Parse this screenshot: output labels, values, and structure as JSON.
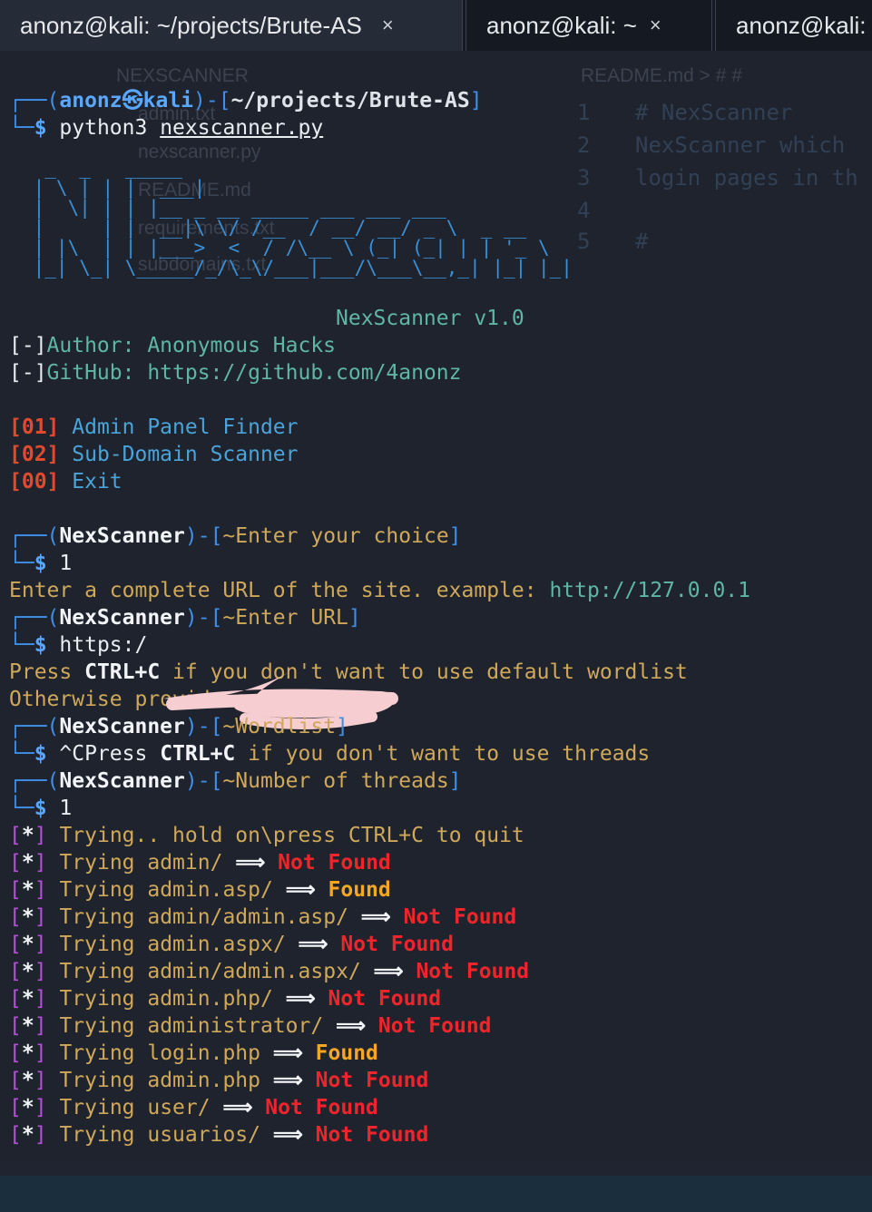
{
  "tabs": [
    {
      "label": "anonz@kali: ~/projects/Brute-AS",
      "close": "×"
    },
    {
      "label": "anonz@kali: ~",
      "close": "×"
    },
    {
      "label": "anonz@kali:"
    }
  ],
  "prompt": {
    "user": "anonz",
    "at": "㉿",
    "host": "kali",
    "path": "~/projects/Brute-AS",
    "command": "python3",
    "script": "nexscanner.py"
  },
  "banner": {
    "art": "  _  _   _____           \n | \\ | | |  ___|          \n |  \\| | | |__ _ __ _____ ___ ___ ___\n |     | |  __|\\ \\/ /__  / __/ __/ _ \\  _ __\n | |\\  | | |___>  <  / /\\__ \\ (_| (_| | | '_ \\\n |_| \\_| \\_____/_/\\_\\/___|___/\\___\\__,_| |_| |_|",
    "version": "NexScanner v1.0"
  },
  "info": [
    {
      "tag": "[-]",
      "text": "Author: Anonymous Hacks"
    },
    {
      "tag": "[-]",
      "text": "GitHub: https://github.com/4anonz"
    }
  ],
  "menu": [
    {
      "num": "[01]",
      "label": "Admin Panel Finder"
    },
    {
      "num": "[02]",
      "label": "Sub-Domain Scanner"
    },
    {
      "num": "[00]",
      "label": "Exit"
    }
  ],
  "session": {
    "tool": "NexScanner",
    "choice_prompt": "~Enter your choice",
    "choice": "1",
    "url_hint": "Enter a complete URL of the site. example: ",
    "url_example": "http://127.0.0.1",
    "url_prompt": "~Enter URL",
    "url_value": "https:/",
    "press": "Press ",
    "ctrlc": "CTRL+C",
    "wordlist_hint_rest": " if you don't want to use default wordlist",
    "wordlist_hint2": "Otherwise provide a wordlist",
    "wordlist_prompt": "~Wordlist",
    "wordlist_value_a": "^CPress ",
    "wordlist_value_b": " if you don't want to use threads",
    "threads_prompt": "~Number of threads",
    "threads_value": "1",
    "trying_msg": "Trying.. hold on\\press CTRL+C to quit"
  },
  "results": [
    {
      "path": "admin/",
      "status": "Not Found"
    },
    {
      "path": "admin.asp/",
      "status": "Found"
    },
    {
      "path": "admin/admin.asp/",
      "status": "Not Found"
    },
    {
      "path": "admin.aspx/",
      "status": "Not Found"
    },
    {
      "path": "admin/admin.aspx/",
      "status": "Not Found"
    },
    {
      "path": "admin.php/",
      "status": "Not Found"
    },
    {
      "path": "administrator/",
      "status": "Not Found"
    },
    {
      "path": "login.php",
      "status": "Found"
    },
    {
      "path": "admin.php",
      "status": "Not Found"
    },
    {
      "path": "user/",
      "status": "Not Found"
    },
    {
      "path": "usuarios/",
      "status": "Not Found"
    }
  ],
  "result_tag": "[*]",
  "result_word": "Trying",
  "arrow": "⟹",
  "ghost": {
    "sidebar": [
      "NEXSCANNER",
      "admin.txt",
      "nexscanner.py",
      "README.md",
      "requirements.txt",
      "subdomains.txt"
    ],
    "breadcrumb": "README.md > # #",
    "code_lines": [
      "# NexScanner",
      "NexScanner which",
      "login pages in th",
      "",
      "#"
    ],
    "line_numbers": [
      "1",
      "2",
      "3",
      "4",
      "5"
    ]
  }
}
